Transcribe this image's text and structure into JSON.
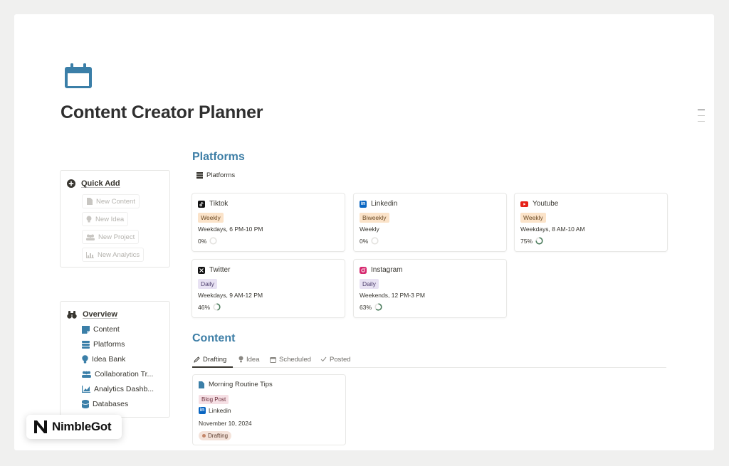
{
  "page": {
    "title": "Content Creator Planner",
    "icon": "calendar-icon"
  },
  "quick_add": {
    "heading": "Quick Add",
    "items": [
      {
        "label": "New Content",
        "icon": "document-icon"
      },
      {
        "label": "New Idea",
        "icon": "lightbulb-icon"
      },
      {
        "label": "New Project",
        "icon": "people-icon"
      },
      {
        "label": "New Analytics",
        "icon": "chart-icon"
      }
    ]
  },
  "overview": {
    "heading": "Overview",
    "items": [
      {
        "label": "Content",
        "icon": "note-icon"
      },
      {
        "label": "Platforms",
        "icon": "stack-icon"
      },
      {
        "label": "Idea Bank",
        "icon": "lightbulb-icon"
      },
      {
        "label": "Collaboration Tr...",
        "icon": "people-icon"
      },
      {
        "label": "Analytics Dashb...",
        "icon": "chart-icon"
      },
      {
        "label": "Databases",
        "icon": "database-icon"
      }
    ]
  },
  "platforms": {
    "heading": "Platforms",
    "view_label": "Platforms",
    "cards": [
      {
        "name": "Tiktok",
        "frequency": "Weekly",
        "freq_style": "weekly",
        "schedule": "Weekdays, 6 PM-10 PM",
        "progress": "0%",
        "progress_value": 0,
        "icon": "tiktok-icon"
      },
      {
        "name": "Linkedin",
        "frequency": "Biweekly",
        "freq_style": "weekly",
        "schedule": "Weekly",
        "progress": "0%",
        "progress_value": 0,
        "icon": "linkedin-icon"
      },
      {
        "name": "Youtube",
        "frequency": "Weekly",
        "freq_style": "weekly",
        "schedule": "Weekdays, 8 AM-10 AM",
        "progress": "75%",
        "progress_value": 0.75,
        "icon": "youtube-icon"
      },
      {
        "name": "Twitter",
        "frequency": "Daily",
        "freq_style": "daily",
        "schedule": "Weekdays, 9 AM-12 PM",
        "progress": "46%",
        "progress_value": 0.46,
        "icon": "x-icon"
      },
      {
        "name": "Instagram",
        "frequency": "Daily",
        "freq_style": "daily",
        "schedule": "Weekends, 12 PM-3 PM",
        "progress": "63%",
        "progress_value": 0.63,
        "icon": "instagram-icon"
      }
    ]
  },
  "content": {
    "heading": "Content",
    "tabs": [
      {
        "label": "Drafting",
        "icon": "pencil-icon",
        "active": true
      },
      {
        "label": "Idea",
        "icon": "lightbulb-icon",
        "active": false
      },
      {
        "label": "Scheduled",
        "icon": "calendar-icon",
        "active": false
      },
      {
        "label": "Posted",
        "icon": "check-icon",
        "active": false
      }
    ],
    "cards": [
      {
        "title": "Morning Routine Tips",
        "type": "Blog Post",
        "platform": "Linkedin",
        "date": "November 10, 2024",
        "status": "Drafting"
      }
    ]
  },
  "brand": {
    "name": "NimbleGot"
  },
  "colors": {
    "accent": "#3d7ea6",
    "progress": "#4a7c5c"
  }
}
